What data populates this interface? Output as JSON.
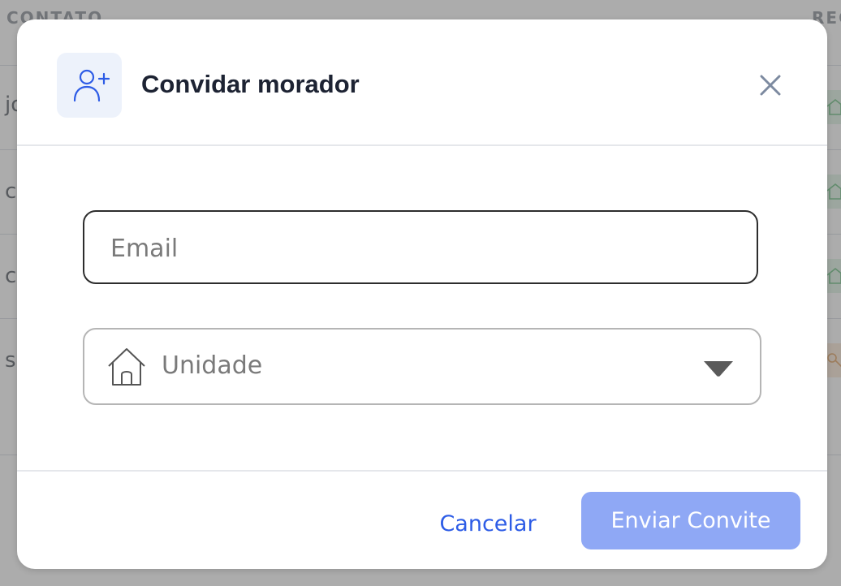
{
  "background": {
    "columns": {
      "contato": "CONTATO",
      "reg": "REG"
    },
    "rows": [
      {
        "text": "jo",
        "badge": "green"
      },
      {
        "text": "c",
        "badge": "green"
      },
      {
        "text": "c",
        "badge": "green"
      },
      {
        "text": "s",
        "badge": "orange"
      }
    ]
  },
  "modal": {
    "title": "Convidar morador",
    "header_icon": "user-plus-icon",
    "close_icon": "close-icon",
    "email": {
      "placeholder": "Email",
      "value": ""
    },
    "unidade": {
      "icon": "house-icon",
      "label": "Unidade",
      "caret_icon": "caret-down-icon"
    },
    "footer": {
      "cancel_label": "Cancelar",
      "send_label": "Enviar Convite"
    }
  },
  "colors": {
    "accent": "#2d5ce6",
    "send_button_disabled": "#8fa8f5",
    "title": "#1d2333",
    "icon_box": "#edf2fb",
    "overlay": "rgba(90,90,90,0.5)"
  }
}
